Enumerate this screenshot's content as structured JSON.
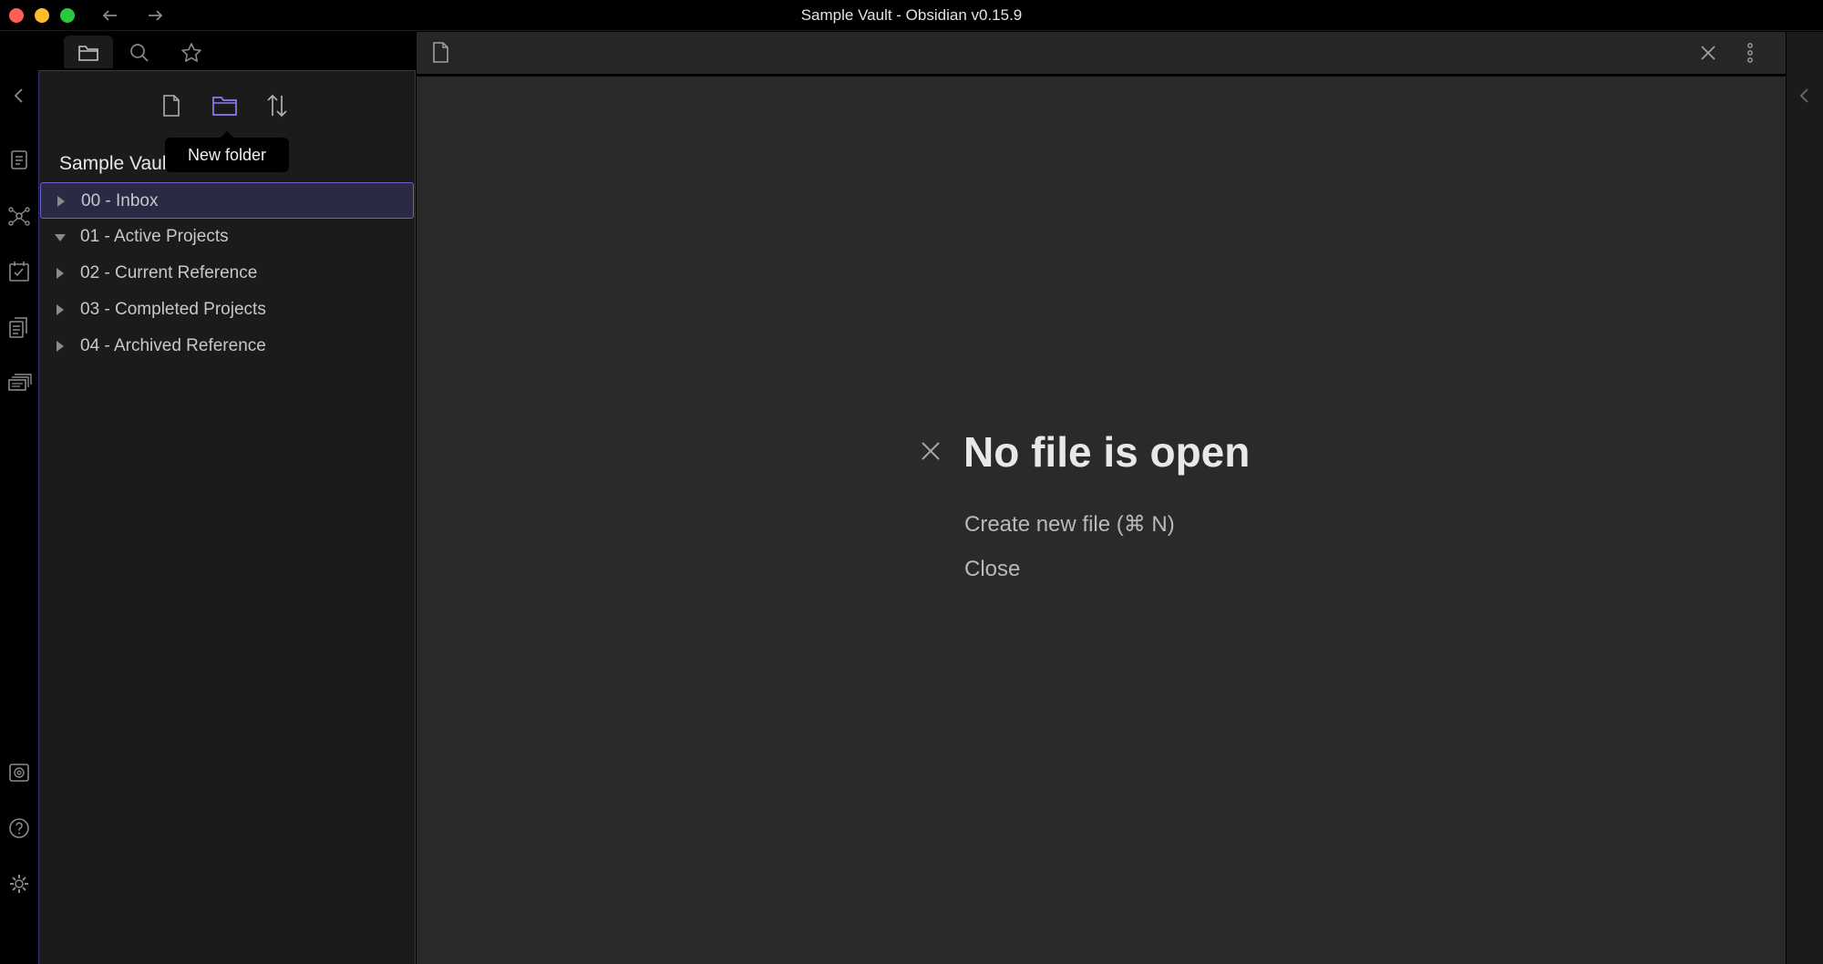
{
  "window": {
    "title": "Sample Vault - Obsidian v0.15.9"
  },
  "colors": {
    "accent": "#7f6df2",
    "background_main": "#2a2a2a",
    "background_sidebar": "#1b1b1b",
    "selected_border": "#6c5fc7"
  },
  "sidebar": {
    "tabs": [
      {
        "icon": "folder-icon",
        "label": "Files"
      },
      {
        "icon": "search-icon",
        "label": "Search"
      },
      {
        "icon": "star-icon",
        "label": "Starred"
      }
    ],
    "file_actions": [
      {
        "icon": "new-note-icon"
      },
      {
        "icon": "new-folder-icon"
      },
      {
        "icon": "sort-icon"
      }
    ],
    "tooltip": "New folder",
    "vault_name": "Sample Vault",
    "folders": [
      {
        "label": "00 - Inbox",
        "expanded": false,
        "selected": true
      },
      {
        "label": "01 - Active Projects",
        "expanded": true,
        "selected": false
      },
      {
        "label": "02 - Current Reference",
        "expanded": false,
        "selected": false
      },
      {
        "label": "03 - Completed Projects",
        "expanded": false,
        "selected": false
      },
      {
        "label": "04 - Archived Reference",
        "expanded": false,
        "selected": false
      }
    ]
  },
  "ribbon": {
    "icons": [
      "collapse-left-icon",
      "quick-switcher-icon",
      "graph-view-icon",
      "daily-note-icon",
      "templates-icon",
      "slides-icon",
      "vault-switcher-icon",
      "help-icon",
      "settings-icon"
    ]
  },
  "editor": {
    "empty_title": "No file is open",
    "actions": {
      "create": "Create new file (⌘ N)",
      "close": "Close"
    }
  }
}
